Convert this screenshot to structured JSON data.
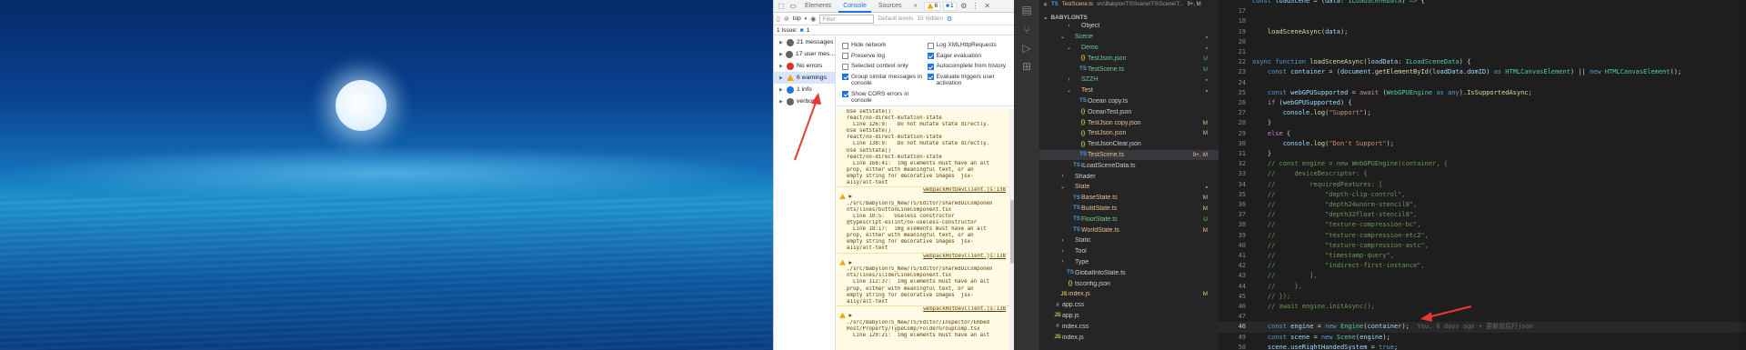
{
  "scene": {
    "description_icon": "moon-icon"
  },
  "devtools": {
    "tabs": [
      "Elements",
      "Console",
      "Sources"
    ],
    "more_tabs": "»",
    "warn_count": "6",
    "info_count": "1",
    "context": "top",
    "filter_placeholder": "Filter",
    "levels": "Default levels",
    "hidden": "15 hidden",
    "issue_text": "1 Issue:",
    "issue_count": "1",
    "sidebar": [
      {
        "label": "21 messages",
        "icon": "list-icon",
        "color": "#5f6368"
      },
      {
        "label": "17 user mes...",
        "icon": "user-icon",
        "color": "#5f6368"
      },
      {
        "label": "No errors",
        "icon": "error-icon",
        "color": "#d93025"
      },
      {
        "label": "6 warnings",
        "icon": "warning-icon",
        "color": "#f2a600"
      },
      {
        "label": "1 info",
        "icon": "info-icon",
        "color": "#1a73e8"
      },
      {
        "label": "verbose",
        "icon": "verbose-icon",
        "color": "#5f6368"
      }
    ],
    "settings_left": [
      {
        "label": "Hide network",
        "checked": false
      },
      {
        "label": "Preserve log",
        "checked": false
      },
      {
        "label": "Selected context only",
        "checked": false
      },
      {
        "label": "Group similar messages in console",
        "checked": true
      },
      {
        "label": "Show CORS errors in console",
        "checked": true
      }
    ],
    "settings_right": [
      {
        "label": "Log XMLHttpRequests",
        "checked": false
      },
      {
        "label": "Eager evaluation",
        "checked": true
      },
      {
        "label": "Autocomplete from history",
        "checked": true
      },
      {
        "label": "Evaluate triggers user activation",
        "checked": true
      }
    ],
    "log_lines": [
      "Use setState()",
      "react/no-direct-mutation-state",
      "  Line 126:9:   Do not mutate state directly.",
      "Use setState()",
      "react/no-direct-mutation-state",
      "  Line 138:9:   Do not mutate state directly.",
      "Use setState()",
      "react/no-direct-mutation-state",
      "  Line 168:41:  img elements must have an alt",
      "prop, either with meaningful text, or an",
      "empty string for decorative images  jsx-",
      "a11y/alt-text",
      "SRC:webpackHotDevClient.js:138",
      "ARROW:▶",
      "./src/BabylonTS_New/TS/Editor/sharedUIComponen",
      "nts/lines/buttonLineComponent.tsx",
      "  Line 10:5:   Useless constructor",
      "@typescript-eslint/no-useless-constructor",
      "  Line 18:17:  img elements must have an alt",
      "prop, either with meaningful text, or an",
      "empty string for decorative images  jsx-",
      "a11y/alt-text",
      "SRC:webpackHotDevClient.js:138",
      "ARROW:▶",
      "./src/BabylonTS_New/TS/Editor/sharedUIComponen",
      "nts/lines/sliderLineComponent.tsx",
      "  Line 112:37:  img elements must have an alt",
      "prop, either with meaningful text, or an",
      "empty string for decorative images  jsx-",
      "a11y/alt-text",
      "SRC:webpackHotDevClient.js:138",
      "ARROW:▶",
      "./src/BabylonTS_New/TS/Editor/Inspector/Embed",
      "Host/Property/TypeComp/FolderGroupComp.tsx",
      "  Line 120:21:  img elements must have an alt"
    ]
  },
  "vscode": {
    "tab_label": "TestScene.ts",
    "tab_path": "src\\BabylonTS\\Scene\\TS\\Scene\\T...",
    "tab_status": "9+, M",
    "explorer_title": "BABYLONTS",
    "tree": [
      {
        "label": "Object",
        "depth": 3,
        "type": "folder",
        "open": false,
        "status": "",
        "scolor": ""
      },
      {
        "label": "Scene",
        "depth": 2,
        "type": "folder",
        "open": true,
        "status": "",
        "scolor": "#73c991"
      },
      {
        "label": "Demo",
        "depth": 3,
        "type": "folder",
        "open": true,
        "status": "",
        "scolor": "#73c991"
      },
      {
        "label": "TestJson.json",
        "depth": 4,
        "type": "json",
        "status": "U",
        "scolor": "#73c991"
      },
      {
        "label": "TestScene.ts",
        "depth": 4,
        "type": "ts",
        "status": "U",
        "scolor": "#73c991"
      },
      {
        "label": "SZZH",
        "depth": 3,
        "type": "folder",
        "open": false,
        "status": "",
        "scolor": "#73c991"
      },
      {
        "label": "Test",
        "depth": 3,
        "type": "folder",
        "open": true,
        "status": "",
        "scolor": "#e2c08d"
      },
      {
        "label": "Ocean copy.ts",
        "depth": 4,
        "type": "ts",
        "status": "",
        "scolor": ""
      },
      {
        "label": "OceanTest.json",
        "depth": 4,
        "type": "json",
        "status": "",
        "scolor": ""
      },
      {
        "label": "TestJson copy.json",
        "depth": 4,
        "type": "json",
        "status": "M",
        "scolor": "#e2c08d"
      },
      {
        "label": "TestJson.json",
        "depth": 4,
        "type": "json",
        "status": "M",
        "scolor": "#e2c08d"
      },
      {
        "label": "TestJsonClear.json",
        "depth": 4,
        "type": "json",
        "status": "",
        "scolor": ""
      },
      {
        "label": "TestScene.ts",
        "depth": 4,
        "type": "ts",
        "status": "9+, M",
        "scolor": "#e2c08d",
        "selected": true
      },
      {
        "label": "ILoadSceneData.ts",
        "depth": 3,
        "type": "ts",
        "status": "",
        "scolor": ""
      },
      {
        "label": "Shader",
        "depth": 2,
        "type": "folder",
        "open": false,
        "status": "",
        "scolor": ""
      },
      {
        "label": "State",
        "depth": 2,
        "type": "folder",
        "open": true,
        "status": "",
        "scolor": "#e2c08d"
      },
      {
        "label": "BaseState.ts",
        "depth": 3,
        "type": "ts",
        "status": "M",
        "scolor": "#e2c08d"
      },
      {
        "label": "BuildState.ts",
        "depth": 3,
        "type": "ts",
        "status": "M",
        "scolor": "#e2c08d"
      },
      {
        "label": "FloorState.ts",
        "depth": 3,
        "type": "ts",
        "status": "U",
        "scolor": "#73c991"
      },
      {
        "label": "WorldState.ts",
        "depth": 3,
        "type": "ts",
        "status": "M",
        "scolor": "#e2c08d"
      },
      {
        "label": "Static",
        "depth": 2,
        "type": "folder",
        "open": false,
        "status": "",
        "scolor": ""
      },
      {
        "label": "Tool",
        "depth": 2,
        "type": "folder",
        "open": false,
        "status": "",
        "scolor": ""
      },
      {
        "label": "Type",
        "depth": 2,
        "type": "folder",
        "open": false,
        "status": "",
        "scolor": ""
      },
      {
        "label": "GlobalInfoState.ts",
        "depth": 2,
        "type": "ts",
        "status": "",
        "scolor": ""
      },
      {
        "label": "tsconfig.json",
        "depth": 2,
        "type": "json",
        "status": "",
        "scolor": ""
      },
      {
        "label": "index.js",
        "depth": 1,
        "type": "js",
        "status": "M",
        "scolor": "#e2c08d"
      },
      {
        "label": "app.css",
        "depth": 0,
        "type": "css",
        "status": "",
        "scolor": ""
      },
      {
        "label": "app.js",
        "depth": 0,
        "type": "js",
        "status": "",
        "scolor": ""
      },
      {
        "label": "index.css",
        "depth": 0,
        "type": "css",
        "status": "",
        "scolor": ""
      },
      {
        "label": "index.js",
        "depth": 0,
        "type": "js",
        "status": "",
        "scolor": ""
      }
    ],
    "code": [
      {
        "n": "",
        "t": "<k>const</k> <v>loadScene</v> = (<v>data</v>: <t>ILoadSceneData</t>) <k>=></k> {"
      },
      {
        "n": "17",
        "t": ""
      },
      {
        "n": "18",
        "t": ""
      },
      {
        "n": "19",
        "t": "    <f>loadSceneAsync</f>(<v>data</v>);"
      },
      {
        "n": "20",
        "t": ""
      },
      {
        "n": "21",
        "t": ""
      },
      {
        "n": "22",
        "t": "<k>async function</k> <f>loadSceneAsync</f>(<v>loadData</v>: <t>ILoadSceneData</t>) {"
      },
      {
        "n": "23",
        "t": "    <k>const</k> <v>container</v> = (<v>document</v>.<f>getElementById</f>(<v>loadData</v>.<v>domID</v>) <k>as</k> <t>HTMLCanvasElement</t>) || <k>new</k> <t>HTMLCanvasElement</t>();"
      },
      {
        "n": "24",
        "t": ""
      },
      {
        "n": "25",
        "t": "    <k>const</k> <v>webGPUSupported</v> = <p>await</p> (<t>WebGPUEngine</t> <k>as</k> <k>any</k>).<f>IsSupportedAsync</f>;"
      },
      {
        "n": "26",
        "t": "    <p>if</p> (<v>webGPUSupported</v>) {"
      },
      {
        "n": "27",
        "t": "        <v>console</v>.<f>log</f>(<s>\"Support\"</s>);"
      },
      {
        "n": "28",
        "t": "    }"
      },
      {
        "n": "29",
        "t": "    <p>else</p> {"
      },
      {
        "n": "30",
        "t": "        <v>console</v>.<f>log</f>(<s>\"Don't Support\"</s>);"
      },
      {
        "n": "31",
        "t": "    }"
      },
      {
        "n": "32",
        "t": "    <c>// const engine = new WebGPUEngine(container, {</c>"
      },
      {
        "n": "33",
        "t": "    <c>//     deviceDescriptor: {</c>"
      },
      {
        "n": "34",
        "t": "    <c>//         requiredFeatures: [</c>"
      },
      {
        "n": "35",
        "t": "    <c>//             \"depth-clip-control\",</c>"
      },
      {
        "n": "36",
        "t": "    <c>//             \"depth24unorm-stencil8\",</c>"
      },
      {
        "n": "37",
        "t": "    <c>//             \"depth32float-stencil8\",</c>"
      },
      {
        "n": "38",
        "t": "    <c>//             \"texture-compression-bc\",</c>"
      },
      {
        "n": "39",
        "t": "    <c>//             \"texture-compression-etc2\",</c>"
      },
      {
        "n": "40",
        "t": "    <c>//             \"texture-compression-astc\",</c>"
      },
      {
        "n": "41",
        "t": "    <c>//             \"timestamp-query\",</c>"
      },
      {
        "n": "42",
        "t": "    <c>//             \"indirect-first-instance\",</c>"
      },
      {
        "n": "43",
        "t": "    <c>//         ],</c>"
      },
      {
        "n": "44",
        "t": "    <c>//     },</c>"
      },
      {
        "n": "45",
        "t": "    <c>// });</c>"
      },
      {
        "n": "46",
        "t": "    <c>// await engine.initAsync();</c>"
      },
      {
        "n": "47",
        "t": ""
      },
      {
        "n": "46",
        "t": "    <k>const</k> <v>engine</v> = <k>new</k> <t>Engine</t>(<v>container</v>);  <g>You, 6 days ago • 更新前后打json</g>",
        "cur": true
      },
      {
        "n": "49",
        "t": "    <k>const</k> <v>scene</v> = <k>new</k> <t>Scene</t>(<v>engine</v>);"
      },
      {
        "n": "50",
        "t": "    <v>scene</v>.<v>useRightHandedSystem</v> = <k>true</k>;"
      }
    ]
  }
}
